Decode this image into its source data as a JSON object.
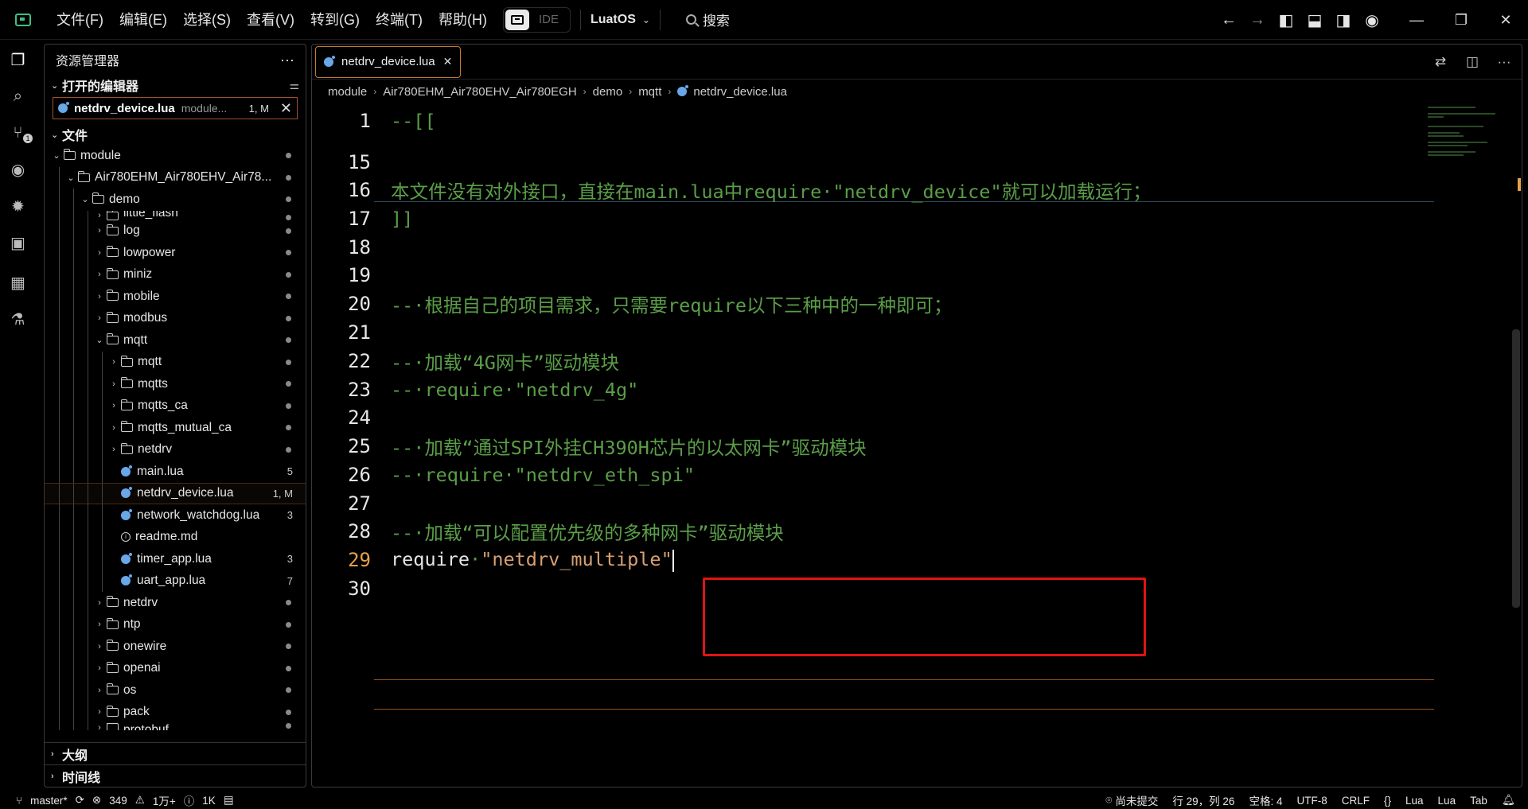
{
  "menu": [
    "文件(F)",
    "编辑(E)",
    "选择(S)",
    "查看(V)",
    "转到(G)",
    "终端(T)",
    "帮助(H)"
  ],
  "ide_label": "IDE",
  "project": "LuatOS",
  "search_label": "搜索",
  "sidebar": {
    "title": "资源管理器",
    "open_editors_label": "打开的编辑器",
    "open_editor": {
      "name": "netdrv_device.lua",
      "path": "module...",
      "badge": "1, M"
    },
    "files_label": "文件",
    "tree": [
      {
        "name": "module",
        "depth": 0,
        "kind": "folder",
        "open": true,
        "dot": true
      },
      {
        "name": "Air780EHM_Air780EHV_Air78...",
        "depth": 1,
        "kind": "folder",
        "open": true,
        "dot": true
      },
      {
        "name": "demo",
        "depth": 2,
        "kind": "folder",
        "open": true,
        "dot": true
      },
      {
        "name": "little_flash",
        "depth": 3,
        "kind": "folder",
        "open": false,
        "dot": true,
        "partial": true
      },
      {
        "name": "log",
        "depth": 3,
        "kind": "folder",
        "open": false,
        "dot": true
      },
      {
        "name": "lowpower",
        "depth": 3,
        "kind": "folder",
        "open": false,
        "dot": true
      },
      {
        "name": "miniz",
        "depth": 3,
        "kind": "folder",
        "open": false,
        "dot": true
      },
      {
        "name": "mobile",
        "depth": 3,
        "kind": "folder",
        "open": false,
        "dot": true
      },
      {
        "name": "modbus",
        "depth": 3,
        "kind": "folder",
        "open": false,
        "dot": true
      },
      {
        "name": "mqtt",
        "depth": 3,
        "kind": "folder",
        "open": true,
        "dot": true
      },
      {
        "name": "mqtt",
        "depth": 4,
        "kind": "folder",
        "open": false,
        "dot": true
      },
      {
        "name": "mqtts",
        "depth": 4,
        "kind": "folder",
        "open": false,
        "dot": true
      },
      {
        "name": "mqtts_ca",
        "depth": 4,
        "kind": "folder",
        "open": false,
        "dot": true
      },
      {
        "name": "mqtts_mutual_ca",
        "depth": 4,
        "kind": "folder",
        "open": false,
        "dot": true
      },
      {
        "name": "netdrv",
        "depth": 4,
        "kind": "folder",
        "open": false,
        "dot": true
      },
      {
        "name": "main.lua",
        "depth": 4,
        "kind": "lua",
        "badge": "5"
      },
      {
        "name": "netdrv_device.lua",
        "depth": 4,
        "kind": "lua",
        "badge": "1, M",
        "selected": true
      },
      {
        "name": "network_watchdog.lua",
        "depth": 4,
        "kind": "lua",
        "badge": "3"
      },
      {
        "name": "readme.md",
        "depth": 4,
        "kind": "info"
      },
      {
        "name": "timer_app.lua",
        "depth": 4,
        "kind": "lua",
        "badge": "3"
      },
      {
        "name": "uart_app.lua",
        "depth": 4,
        "kind": "lua",
        "badge": "7"
      },
      {
        "name": "netdrv",
        "depth": 3,
        "kind": "folder",
        "open": false,
        "dot": true
      },
      {
        "name": "ntp",
        "depth": 3,
        "kind": "folder",
        "open": false,
        "dot": true
      },
      {
        "name": "onewire",
        "depth": 3,
        "kind": "folder",
        "open": false,
        "dot": true
      },
      {
        "name": "openai",
        "depth": 3,
        "kind": "folder",
        "open": false,
        "dot": true
      },
      {
        "name": "os",
        "depth": 3,
        "kind": "folder",
        "open": false,
        "dot": true
      },
      {
        "name": "pack",
        "depth": 3,
        "kind": "folder",
        "open": false,
        "dot": true
      },
      {
        "name": "protobuf",
        "depth": 3,
        "kind": "folder",
        "open": false,
        "dot": true,
        "partial": true
      }
    ],
    "outline_label": "大纲",
    "timeline_label": "时间线"
  },
  "editor": {
    "tab": "netdrv_device.lua",
    "breadcrumb": [
      "module",
      "Air780EHM_Air780EHV_Air780EGH",
      "demo",
      "mqtt",
      "netdrv_device.lua"
    ],
    "lines": [
      {
        "n": "1",
        "parts": [
          {
            "t": "--[[",
            "c": "comment"
          }
        ]
      },
      {
        "n": "15",
        "parts": []
      },
      {
        "n": "16",
        "parts": [
          {
            "t": "本文件没有对外接口，直接在main.lua中require·\"netdrv_device\"就可以加载运行；",
            "c": "comment"
          }
        ]
      },
      {
        "n": "17",
        "parts": [
          {
            "t": "]]",
            "c": "comment"
          }
        ]
      },
      {
        "n": "18",
        "parts": []
      },
      {
        "n": "19",
        "parts": []
      },
      {
        "n": "20",
        "parts": [
          {
            "t": "--·根据自己的项目需求，只需要require以下三种中的一种即可；",
            "c": "comment"
          }
        ]
      },
      {
        "n": "21",
        "parts": []
      },
      {
        "n": "22",
        "parts": [
          {
            "t": "--·加载“4G网卡”驱动模块",
            "c": "comment"
          }
        ]
      },
      {
        "n": "23",
        "parts": [
          {
            "t": "--·require·\"netdrv_4g\"",
            "c": "comment"
          }
        ]
      },
      {
        "n": "24",
        "parts": []
      },
      {
        "n": "25",
        "parts": [
          {
            "t": "--·加载“通过SPI外挂CH390H芯片的以太网卡”驱动模块",
            "c": "comment"
          }
        ]
      },
      {
        "n": "26",
        "parts": [
          {
            "t": "--·require·\"netdrv_eth_spi\"",
            "c": "comment"
          }
        ]
      },
      {
        "n": "27",
        "parts": []
      },
      {
        "n": "28",
        "parts": [
          {
            "t": "--·加载“可以配置优先级的多种网卡”驱动模块",
            "c": "comment"
          }
        ]
      },
      {
        "n": "29",
        "parts": [
          {
            "t": "require",
            "c": "kw"
          },
          {
            "t": "·",
            "c": "comment"
          },
          {
            "t": "\"netdrv_multiple\"",
            "c": "str"
          }
        ],
        "current": true
      },
      {
        "n": "30",
        "parts": []
      }
    ]
  },
  "status": {
    "branch": "master*",
    "errors": "349",
    "warnings": "1万+",
    "infos": "1K",
    "uncommitted": "尚未提交",
    "position": "行 29，列 26",
    "spaces": "空格: 4",
    "encoding": "UTF-8",
    "eol": "CRLF",
    "braces": "{}",
    "language": "Lua",
    "lua_status": "Lua",
    "tab": "Tab"
  },
  "colors": {
    "accent": "#c77a2e",
    "comment": "#5a9e48",
    "string": "#d9a071",
    "highlight_box": "#e01414"
  }
}
